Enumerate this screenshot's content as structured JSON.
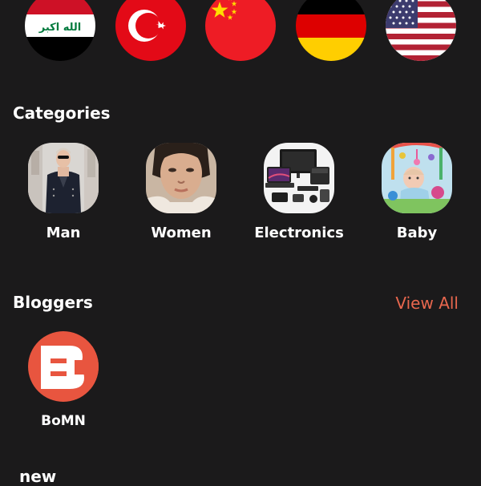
{
  "flags": [
    {
      "name": "iraq-flag",
      "flag_text": "الله اكبر"
    },
    {
      "name": "turkey-flag"
    },
    {
      "name": "china-flag"
    },
    {
      "name": "germany-flag"
    },
    {
      "name": "usa-flag"
    }
  ],
  "categories": {
    "title": "Categories",
    "items": [
      {
        "label": "Man",
        "icon": "man-photo"
      },
      {
        "label": "Women",
        "icon": "women-photo"
      },
      {
        "label": "Electronics",
        "icon": "electronics-photo"
      },
      {
        "label": "Baby",
        "icon": "baby-photo"
      }
    ]
  },
  "bloggers": {
    "title": "Bloggers",
    "view_all": "View All",
    "items": [
      {
        "name": "BoMN",
        "icon": "bomn-logo"
      }
    ]
  },
  "new_section": {
    "title": "new"
  },
  "colors": {
    "background": "#1b1a1b",
    "accent": "#e8674e",
    "text": "#ffffff"
  }
}
